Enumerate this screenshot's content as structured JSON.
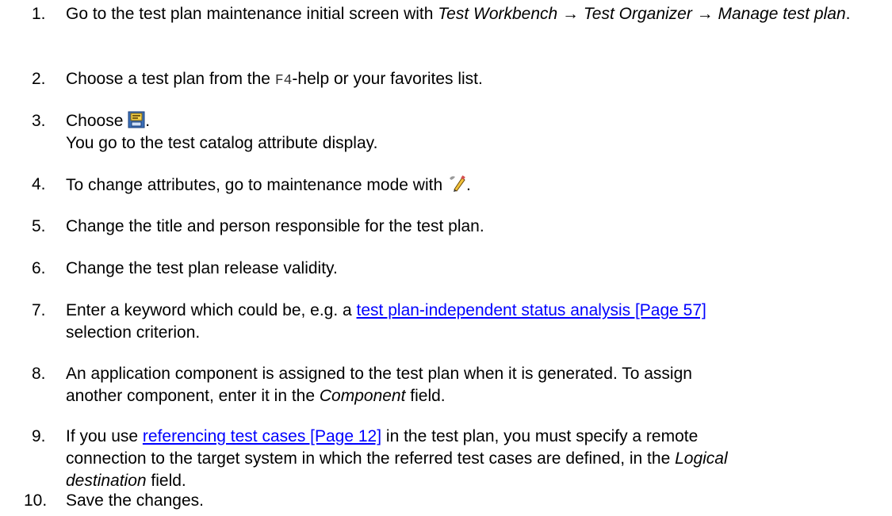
{
  "steps": [
    {
      "number": "1.",
      "text_a": "Go to the test plan maintenance initial screen with ",
      "menu_path": "Test Workbench → Test Organizer → Manage test plan",
      "text_b": "."
    },
    {
      "number": "2.",
      "text_a": "Choose a test plan from the ",
      "code": "F4",
      "text_b": "-help or your favorites list."
    },
    {
      "number": "3.",
      "text_a": "Choose",
      "icon": "test-catalog-attributes-icon",
      "text_b": ".",
      "line2": "You go to the test catalog attribute display."
    },
    {
      "number": "4.",
      "text_a": "To change attributes, go to maintenance mode with",
      "icon": "display-change-pencil-icon",
      "text_b": "."
    },
    {
      "number": "5.",
      "text": "Change the title and person responsible for the test plan."
    },
    {
      "number": "6.",
      "text": "Change the test plan release validity."
    },
    {
      "number": "7.",
      "text_a": "Enter a keyword which could be, e.g. a ",
      "link": "test plan-independent status analysis [Page 57]",
      "line2": "selection criterion."
    },
    {
      "number": "8.",
      "line1": "An application component is assigned to the test plan when it is generated. To assign",
      "text_a": "another component, enter it in the ",
      "field": "Component",
      "text_b": " field."
    },
    {
      "number": "9.",
      "text_a": "If you use ",
      "link": "referencing test cases [Page 12]",
      "text_b": " in the test plan, you must specify a remote",
      "line2_a": "connection to the target system in which the referred test cases are defined, in the ",
      "field_1": "Logical",
      "field_2": "destination",
      "text_c": " field."
    },
    {
      "number": "10.",
      "text": "Save the changes."
    }
  ],
  "colors": {
    "link": "#0000ff",
    "text": "#000000"
  }
}
